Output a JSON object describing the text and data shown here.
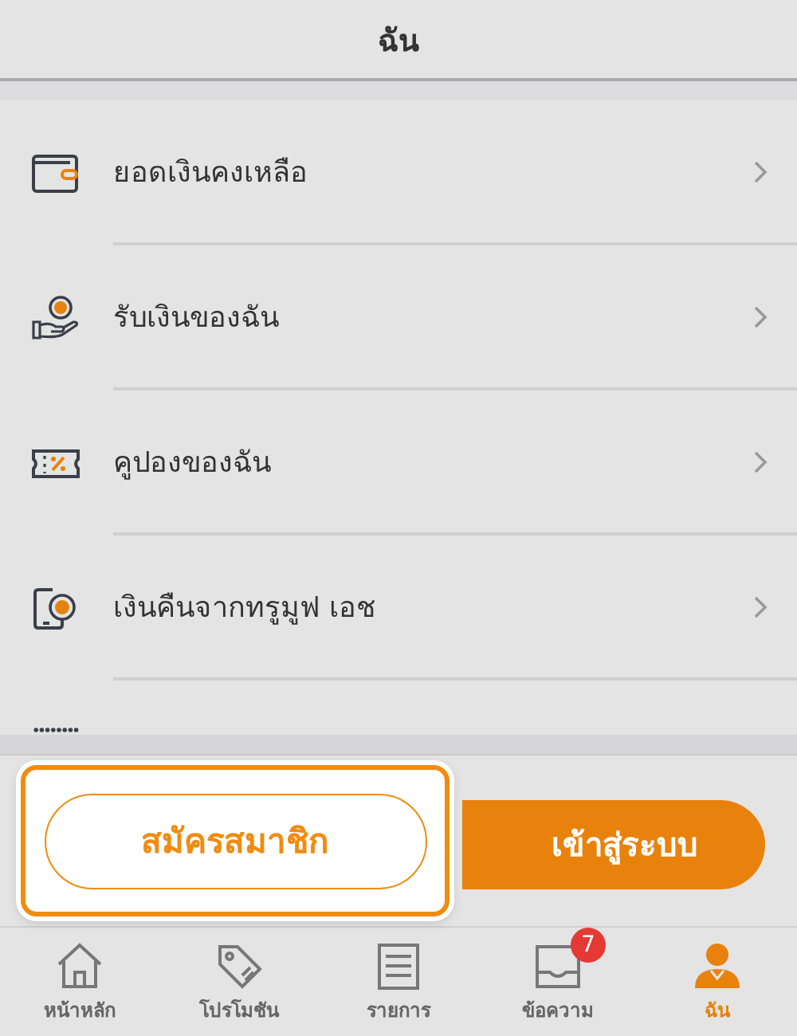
{
  "header": {
    "title": "ฉัน"
  },
  "menu": [
    {
      "label": "ยอดเงินคงเหลือ",
      "kind": "wallet"
    },
    {
      "label": "รับเงินของฉัน",
      "kind": "receive"
    },
    {
      "label": "คูปองของฉัน",
      "kind": "coupon"
    },
    {
      "label": "เงินคืนจากทรูมูฟ เอช",
      "kind": "cashback"
    }
  ],
  "partial_row": {
    "kind": "dots"
  },
  "actions": {
    "register": {
      "label": "สมัครสมาชิก",
      "highlighted": true
    },
    "login": {
      "label": "เข้าสู่ระบบ"
    }
  },
  "tabs": [
    {
      "label": "หน้าหลัก",
      "kind": "home",
      "selected": false
    },
    {
      "label": "โปรโมชัน",
      "kind": "tag",
      "selected": false
    },
    {
      "label": "รายการ",
      "kind": "list",
      "selected": false
    },
    {
      "label": "ข้อความ",
      "kind": "inbox",
      "selected": false,
      "badge": "7"
    },
    {
      "label": "ฉัน",
      "kind": "person",
      "selected": true
    }
  ]
}
